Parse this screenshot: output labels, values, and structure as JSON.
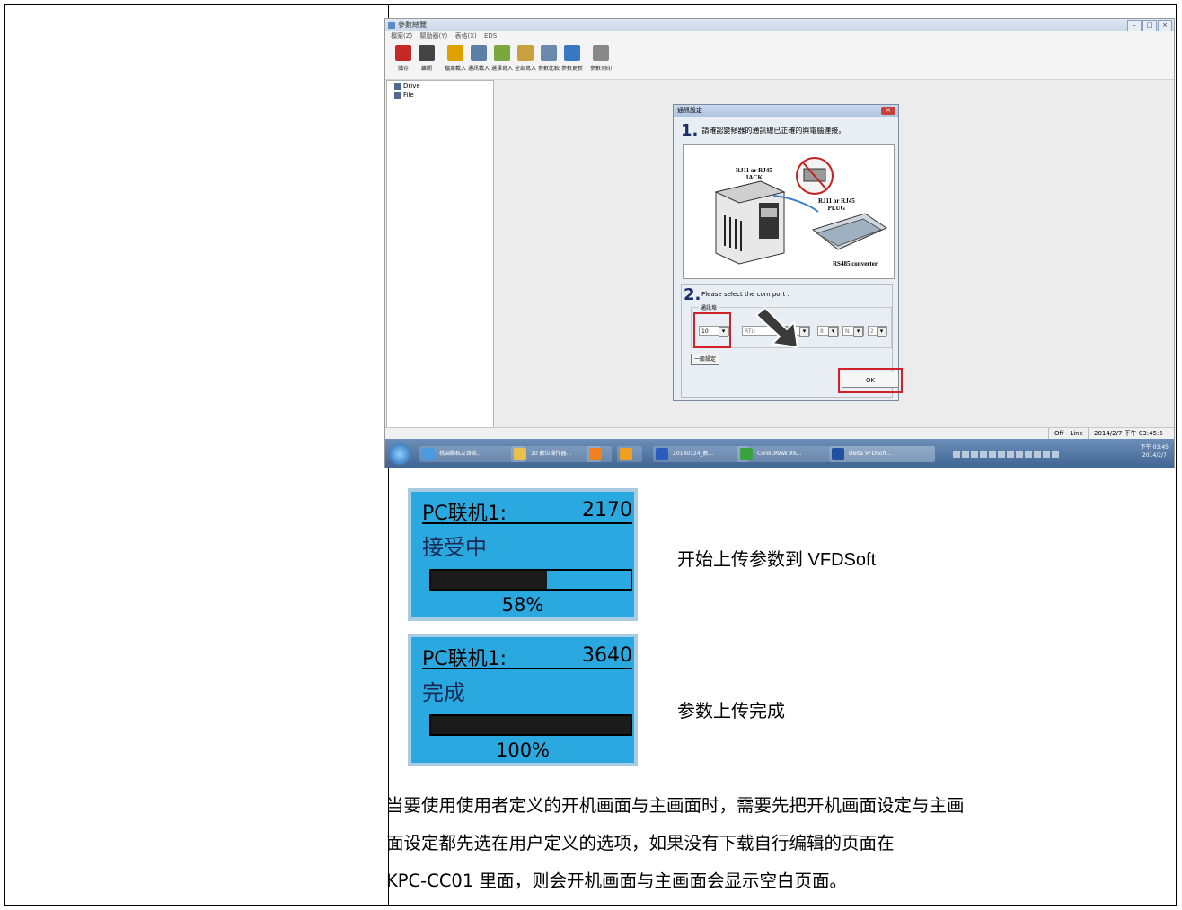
{
  "software_window": {
    "title": "參數總覽",
    "menu": [
      "檔案(Z)",
      "驅動器(Y)",
      "表格(X)",
      "EDS"
    ],
    "toolbar": [
      {
        "label": "儲存",
        "color": "#c62828"
      },
      {
        "label": "離開",
        "color": "#444444"
      },
      {
        "label": "檔案載入",
        "color": "#e0a000"
      },
      {
        "label": "通訊載入",
        "color": "#5c7fa8"
      },
      {
        "label": "選擇寫入",
        "color": "#7aa83c"
      },
      {
        "label": "全部寫入",
        "color": "#c9a040"
      },
      {
        "label": "參數比較",
        "color": "#6b88ad"
      },
      {
        "label": "參數更新",
        "color": "#3a78c2"
      },
      {
        "label": "參數列印",
        "color": "#888888"
      }
    ],
    "tree": [
      "Drive",
      "File"
    ],
    "status": {
      "mode": "Off - Line",
      "datetime": "2014/2/7 下午 03:45:5"
    },
    "taskbar": [
      "桃園縣私立啓英...",
      "10 數位操作器...",
      "",
      "",
      "20140124_數...",
      "CorelDRAW X6...",
      "Delta VFDSoft..."
    ],
    "clock": [
      "下午 03:45",
      "2014/2/7"
    ]
  },
  "dialog": {
    "title": "通訊設定",
    "close": "✕",
    "step1_num": "1.",
    "step1_text": "請確認變頻器的通訊線已正確的與電腦連接。",
    "diagram_labels": {
      "jack": "RJ11 or RJ45\nJACK",
      "plug": "RJ11 or RJ45\nPLUG",
      "converter": "RS485 converter"
    },
    "step2_num": "2.",
    "step2_text": "Please select the com port .",
    "group_label": "通訊埠",
    "com_port": "10",
    "protocol": "RTU",
    "params": [
      "8",
      "N",
      "2"
    ],
    "general_button": "一般設定",
    "ok_button": "OK"
  },
  "panels": [
    {
      "title": "PC联机1:",
      "count": "2170",
      "status": "接受中",
      "percent_label": "58%",
      "progress": 0.58,
      "caption": "开始上传参数到 VFDSoft"
    },
    {
      "title": "PC联机1:",
      "count": "3640",
      "status": "完成",
      "percent_label": "100%",
      "progress": 1.0,
      "caption": "参数上传完成"
    }
  ],
  "paragraph": [
    "当要使用使用者定义的开机画面与主画面时，需要先把开机画面设定与主画",
    "面设定都先选在用户定义的选项，如果没有下载自行编辑的页面在",
    "KPC-CC01 里面，则会开机画面与主画面会显示空白页面。"
  ],
  "colors": {
    "lcd_bg": "#2aa9e1",
    "lcd_frame": "#a9cce2",
    "highlight": "#d02028"
  }
}
